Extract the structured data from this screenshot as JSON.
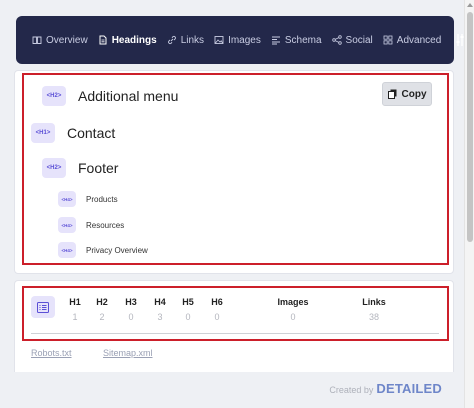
{
  "nav": {
    "items": [
      {
        "label": "Overview",
        "icon": "book-icon",
        "active": false
      },
      {
        "label": "Headings",
        "icon": "document-icon",
        "active": true
      },
      {
        "label": "Links",
        "icon": "link-icon",
        "active": false
      },
      {
        "label": "Images",
        "icon": "image-icon",
        "active": false
      },
      {
        "label": "Schema",
        "icon": "list-icon",
        "active": false
      },
      {
        "label": "Social",
        "icon": "share-icon",
        "active": false
      },
      {
        "label": "Advanced",
        "icon": "grid-icon",
        "active": false
      }
    ],
    "settings_icon": "sliders-icon"
  },
  "headings": {
    "copy_label": "Copy",
    "items": [
      {
        "tag": "<H2>",
        "text": "Additional menu"
      },
      {
        "tag": "<H1>",
        "text": "Contact"
      },
      {
        "tag": "<H2>",
        "text": "Footer"
      },
      {
        "tag": "<H4>",
        "text": "Products"
      },
      {
        "tag": "<H4>",
        "text": "Resources"
      },
      {
        "tag": "<H4>",
        "text": "Privacy Overview"
      }
    ]
  },
  "stats": {
    "icon": "list-view-icon",
    "columns": [
      {
        "label": "H1",
        "value": "1"
      },
      {
        "label": "H2",
        "value": "2"
      },
      {
        "label": "H3",
        "value": "0"
      },
      {
        "label": "H4",
        "value": "3"
      },
      {
        "label": "H5",
        "value": "0"
      },
      {
        "label": "H6",
        "value": "0"
      },
      {
        "label": "Images",
        "value": "0"
      },
      {
        "label": "Links",
        "value": "38"
      }
    ]
  },
  "links": {
    "robots": "Robots.txt",
    "sitemap": "Sitemap.xml"
  },
  "footer": {
    "created_by": "Created by",
    "brand": "DETAILED"
  },
  "colors": {
    "nav_bg": "#23284a",
    "highlight_border": "#cc1f2a",
    "badge_bg": "#e6e3fb",
    "badge_text": "#5b4fd6",
    "brand": "#6e86c9"
  }
}
